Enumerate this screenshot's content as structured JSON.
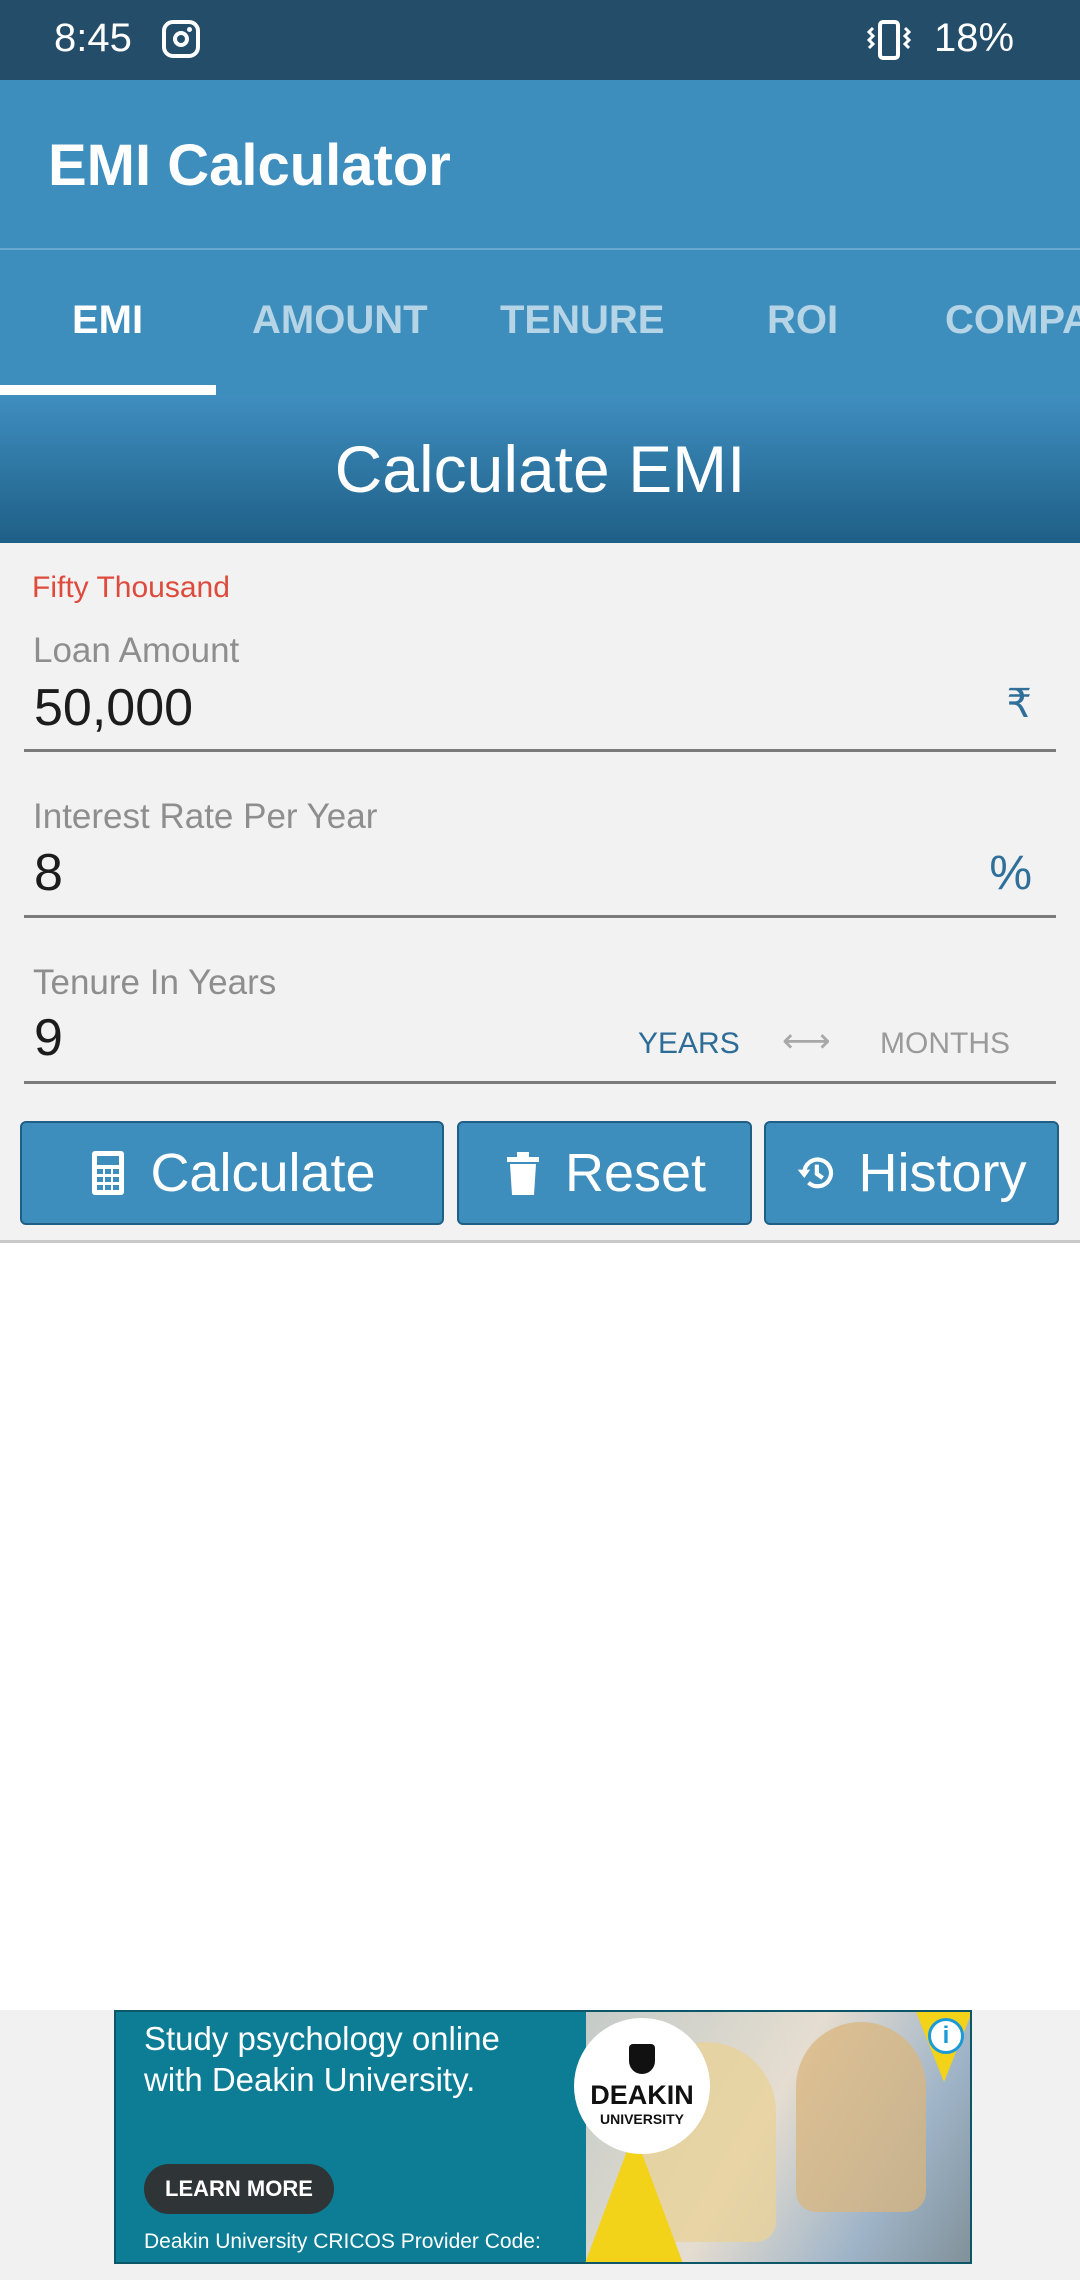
{
  "status_bar": {
    "time": "8:45",
    "battery": "18%",
    "icons": [
      "instagram-icon",
      "vibrate-icon"
    ]
  },
  "app_bar": {
    "title": "EMI Calculator"
  },
  "tabs": [
    {
      "label": "EMI",
      "active": true
    },
    {
      "label": "AMOUNT",
      "active": false
    },
    {
      "label": "TENURE",
      "active": false
    },
    {
      "label": "ROI",
      "active": false
    },
    {
      "label": "COMPA",
      "active": false
    }
  ],
  "heading": "Calculate EMI",
  "form": {
    "amount_in_words": "Fifty Thousand",
    "loan_amount": {
      "label": "Loan Amount",
      "value": "50,000",
      "suffix": "₹"
    },
    "interest_rate": {
      "label": "Interest Rate Per Year",
      "value": "8",
      "suffix": "%"
    },
    "tenure": {
      "label": "Tenure In Years",
      "value": "9",
      "unit_years": "YEARS",
      "unit_months": "MONTHS",
      "swap_symbol": "⟷",
      "selected_unit": "YEARS"
    }
  },
  "buttons": {
    "calculate": "Calculate",
    "reset": "Reset",
    "history": "History"
  },
  "ad": {
    "headline": "Study psychology online with Deakin University.",
    "logo_name": "DEAKIN",
    "logo_sub": "UNIVERSITY",
    "cta": "LEARN MORE",
    "footer": "Deakin University CRICOS Provider Code:",
    "info_symbol": "i"
  },
  "colors": {
    "status_bar": "#234d69",
    "primary": "#3e8ebd",
    "accent_red": "#de4a3b",
    "field_accent": "#2f6f99"
  }
}
